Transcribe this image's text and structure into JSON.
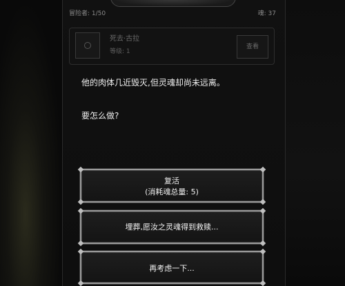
{
  "status_bar": {
    "left_text": "冒险者: 1/50",
    "right_text": "魂: 37"
  },
  "character": {
    "name": "死去·古拉",
    "level": "等级: 1",
    "detail_button": "查看"
  },
  "story": {
    "line1": "他的肉体几近毁灭,但灵魂却尚未远离。",
    "question": "要怎么做?"
  },
  "choices": [
    {
      "label": "复活",
      "sub": "(消耗魂总量: 5)"
    },
    {
      "label": "埋葬,愿汝之灵魂得到救赎..."
    },
    {
      "label": "再考虑一下..."
    }
  ]
}
